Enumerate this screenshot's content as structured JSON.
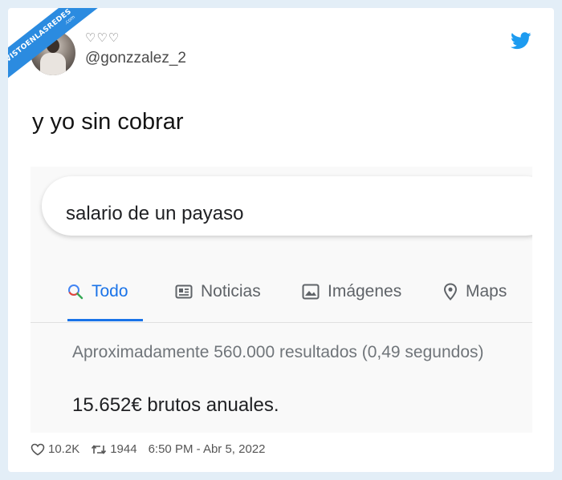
{
  "watermark": {
    "line1": "VISTOENLASREDES",
    "line2": ".com"
  },
  "tweet": {
    "display_name": "♡♡♡",
    "handle": "@gonzzalez_2",
    "text": "y yo sin cobrar",
    "likes": "10.2K",
    "retweets": "1944",
    "timestamp": "6:50 PM - Abr 5, 2022"
  },
  "search_screenshot": {
    "query": "salario de un payaso",
    "tabs": [
      {
        "label": "Todo",
        "icon": "search-icon",
        "active": true
      },
      {
        "label": "Noticias",
        "icon": "news-icon",
        "active": false
      },
      {
        "label": "Imágenes",
        "icon": "image-icon",
        "active": false
      },
      {
        "label": "Maps",
        "icon": "map-pin-icon",
        "active": false
      }
    ],
    "results_stats": "Aproximadamente 560.000 resultados (0,49 segundos)",
    "answer": "15.652€ brutos anuales."
  },
  "colors": {
    "page_background": "#e3eef7",
    "twitter_blue": "#1d9bf0",
    "google_blue": "#1a73e8",
    "watermark_blue": "#2b8be0"
  }
}
